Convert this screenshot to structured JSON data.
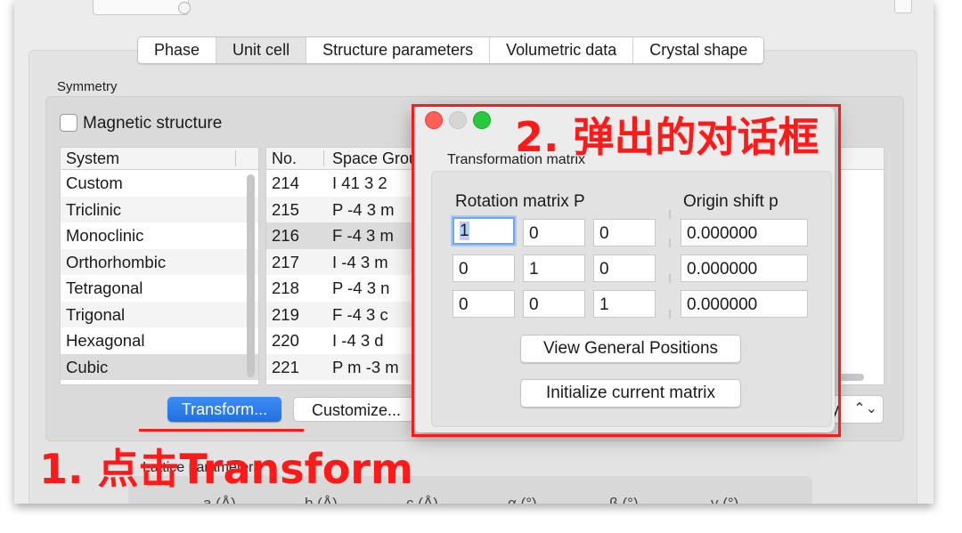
{
  "tabs": [
    "Phase",
    "Unit cell",
    "Structure parameters",
    "Volumetric data",
    "Crystal shape"
  ],
  "symmetry": {
    "title": "Symmetry",
    "magnetic_label": "Magnetic structure",
    "system_header": "System",
    "systems": [
      "Custom",
      "Triclinic",
      "Monoclinic",
      "Orthorhombic",
      "Tetragonal",
      "Trigonal",
      "Hexagonal",
      "Cubic"
    ],
    "no_header": "No.",
    "sg_header": "Space Group",
    "space_groups": [
      {
        "no": "214",
        "name": "I 41 3 2"
      },
      {
        "no": "215",
        "name": "P -4 3 m"
      },
      {
        "no": "216",
        "name": "F -4 3 m"
      },
      {
        "no": "217",
        "name": "I -4 3 m"
      },
      {
        "no": "218",
        "name": "P -4 3 n"
      },
      {
        "no": "219",
        "name": "F -4 3 c"
      },
      {
        "no": "220",
        "name": "I -4 3 d"
      },
      {
        "no": "221",
        "name": "P m -3 m"
      }
    ],
    "transform_button": "Transform...",
    "customize_button": "Customize...",
    "right_popup_text": "ry",
    "right_popup_arrows": "⌃⌄"
  },
  "lattice": {
    "title": "Lattice parameters",
    "headers": [
      "a (Å)",
      "b (Å)",
      "c (Å)",
      "α (°)",
      "β (°)",
      "γ (°)"
    ]
  },
  "dialog": {
    "section_title": "Transformation matrix",
    "rotation_header": "Rotation matrix P",
    "origin_header": "Origin shift p",
    "matrix": [
      [
        "1",
        "0",
        "0"
      ],
      [
        "0",
        "1",
        "0"
      ],
      [
        "0",
        "0",
        "1"
      ]
    ],
    "origin": [
      "0.000000",
      "0.000000",
      "0.000000"
    ],
    "view_button": "View General Positions",
    "init_button": "Initialize current matrix"
  },
  "annotations": {
    "step1": "1. 点击Transform",
    "step2": "2. 弹出的对话框"
  },
  "colors": {
    "annotation_red": "#ff1a1a",
    "accent_blue": "#2a7ff0",
    "close": "#ff5f57",
    "maximize": "#28c840"
  }
}
